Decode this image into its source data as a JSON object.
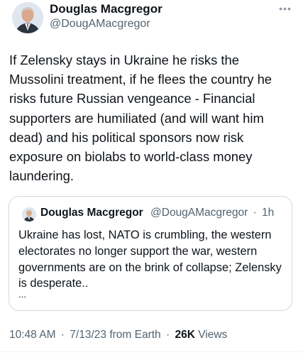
{
  "tweet": {
    "author_name": "Douglas Macgregor",
    "author_handle": "@DougAMacgregor",
    "more_icon": "more-horizontal-icon",
    "text": "If Zelensky stays in Ukraine he risks the Mussolini treatment, if he flees the country he risks future Russian vengeance - Financial supporters are humiliated (and will want him dead) and his political sponsors now risk exposure on biolabs to world-class money laundering."
  },
  "quoted": {
    "author_name": "Douglas Macgregor",
    "author_handle": "@DougAMacgregor",
    "separator": "·",
    "time": "1h",
    "text": "Ukraine has lost, NATO is crumbling, the western electorates no longer support the war, western governments are on the brink of collapse; Zelensky is desperate..",
    "ellipsis": "..."
  },
  "meta": {
    "time": "10:48 AM",
    "date_sep": "·",
    "date": "7/13/23 from Earth",
    "views_sep": "·",
    "views_count": "26K",
    "views_label": "Views"
  },
  "colors": {
    "text_primary": "#0f1419",
    "text_secondary": "#536471",
    "border": "#cfd9de"
  }
}
